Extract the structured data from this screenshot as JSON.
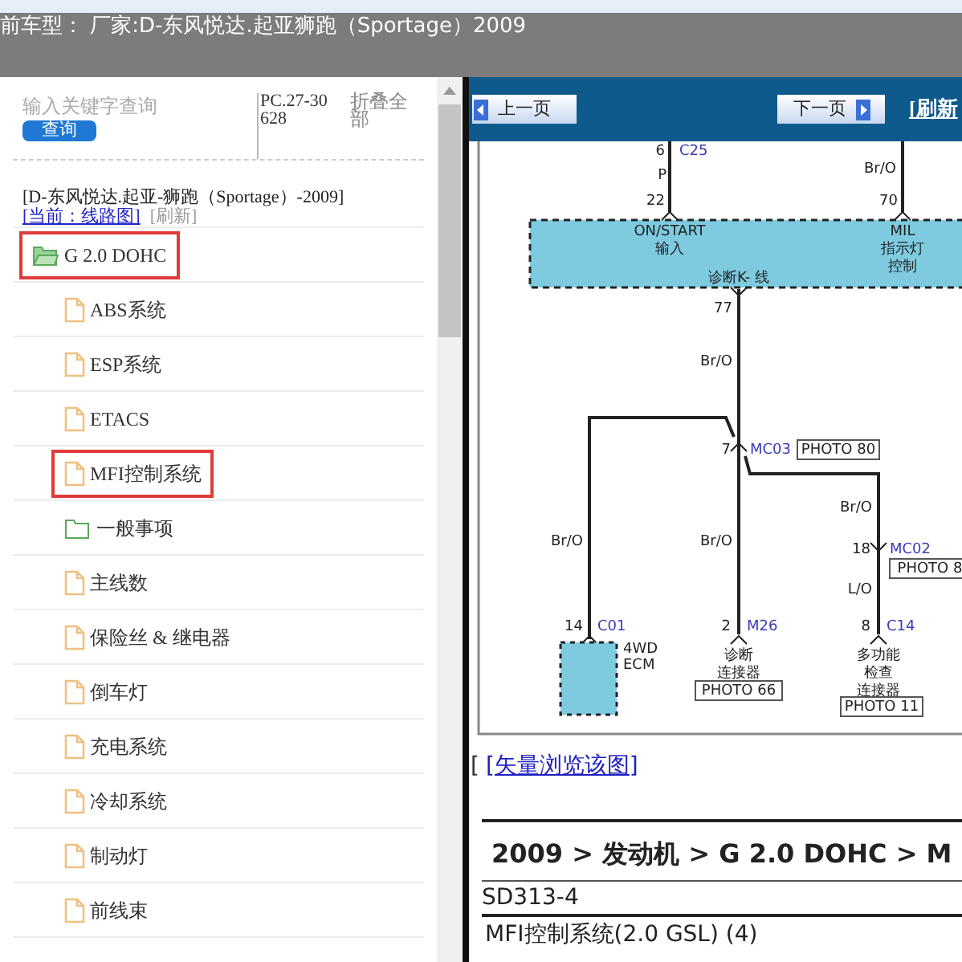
{
  "title_bar": {
    "text": "前车型：  厂家:D-东风悦达.起亚狮跑（Sportage）2009"
  },
  "sidebar": {
    "search": {
      "placeholder": "输入关键字查询",
      "button": "查询"
    },
    "code": "PC.27-30628",
    "collapse": "折叠全部",
    "vehicle": "[D-东风悦达.起亚-狮跑（Sportage）-2009]",
    "current_link": "[当前：线路图]",
    "refresh": "[刷新]",
    "tree": [
      {
        "label": "G 2.0 DOHC",
        "kind": "folder",
        "expanded": true,
        "highlighted": true,
        "children": [
          {
            "label": "ABS系统",
            "kind": "file",
            "highlighted": false
          },
          {
            "label": "ESP系统",
            "kind": "file",
            "highlighted": false
          },
          {
            "label": "ETACS",
            "kind": "file",
            "highlighted": false
          },
          {
            "label": "MFI控制系统",
            "kind": "file",
            "highlighted": true
          },
          {
            "label": "一般事项",
            "kind": "folder",
            "expanded": false,
            "highlighted": false
          },
          {
            "label": "主线数",
            "kind": "file",
            "highlighted": false
          },
          {
            "label": "保险丝 & 继电器",
            "kind": "file",
            "highlighted": false
          },
          {
            "label": "倒车灯",
            "kind": "file",
            "highlighted": false
          },
          {
            "label": "充电系统",
            "kind": "file",
            "highlighted": false
          },
          {
            "label": "冷却系统",
            "kind": "file",
            "highlighted": false
          },
          {
            "label": "制动灯",
            "kind": "file",
            "highlighted": false
          },
          {
            "label": "前线束",
            "kind": "file",
            "highlighted": false
          }
        ]
      }
    ]
  },
  "toolbar": {
    "prev": "上一页",
    "next": "下一页",
    "refresh": "[刷新"
  },
  "diagram": {
    "labels": [
      {
        "text": "6",
        "kind": "pin"
      },
      {
        "text": "C25",
        "kind": "connector"
      },
      {
        "text": "P",
        "kind": "wire"
      },
      {
        "text": "22",
        "kind": "pin"
      },
      {
        "text": "Br/O",
        "kind": "wire"
      },
      {
        "text": "70",
        "kind": "pin"
      },
      {
        "text": "ON/START",
        "kind": "text"
      },
      {
        "text": "输入",
        "kind": "text"
      },
      {
        "text": "MIL",
        "kind": "text"
      },
      {
        "text": "指示灯",
        "kind": "text"
      },
      {
        "text": "控制",
        "kind": "text"
      },
      {
        "text": "诊断K- 线",
        "kind": "text"
      },
      {
        "text": "77",
        "kind": "pin"
      },
      {
        "text": "Br/O",
        "kind": "wire"
      },
      {
        "text": "7",
        "kind": "pin"
      },
      {
        "text": "MC03",
        "kind": "connector"
      },
      {
        "text": "PHOTO 80",
        "kind": "photo"
      },
      {
        "text": "Br/O",
        "kind": "wire"
      },
      {
        "text": "Br/O",
        "kind": "wire"
      },
      {
        "text": "Br/O",
        "kind": "wire"
      },
      {
        "text": "18",
        "kind": "pin"
      },
      {
        "text": "MC02",
        "kind": "connector"
      },
      {
        "text": "PHOTO 8",
        "kind": "photo"
      },
      {
        "text": "L/O",
        "kind": "wire"
      },
      {
        "text": "14",
        "kind": "pin"
      },
      {
        "text": "C01",
        "kind": "connector"
      },
      {
        "text": "4WD",
        "kind": "text"
      },
      {
        "text": "ECM",
        "kind": "text"
      },
      {
        "text": "2",
        "kind": "pin"
      },
      {
        "text": "M26",
        "kind": "connector"
      },
      {
        "text": "诊断",
        "kind": "text"
      },
      {
        "text": "连接器",
        "kind": "text"
      },
      {
        "text": "PHOTO 66",
        "kind": "photo"
      },
      {
        "text": "8",
        "kind": "pin"
      },
      {
        "text": "C14",
        "kind": "connector"
      },
      {
        "text": "多功能",
        "kind": "text"
      },
      {
        "text": "检查",
        "kind": "text"
      },
      {
        "text": "连接器",
        "kind": "text"
      },
      {
        "text": "PHOTO 11",
        "kind": "photo"
      }
    ]
  },
  "vector_link": {
    "bracket": "[",
    "text": "[矢量浏览该图]"
  },
  "breadcrumb": "2009 > 发动机 > G 2.0 DOHC > M",
  "doc_code": "SD313-4",
  "doc_title": "MFI控制系统(2.0 GSL) (4)"
}
